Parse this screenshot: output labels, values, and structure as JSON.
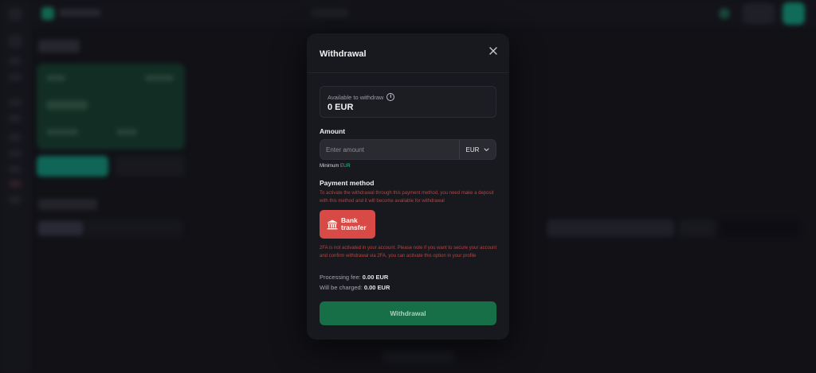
{
  "colors": {
    "accent_green": "#22c985",
    "submit_green": "#176f47",
    "bank_red": "#d84a45",
    "warning_red": "#b8443f",
    "modal_bg": "#18191e"
  },
  "modal": {
    "title": "Withdrawal",
    "close_icon": "close-icon",
    "balance": {
      "label": "Available to withdraw",
      "info_icon": "info-icon",
      "value": "0 EUR"
    },
    "amount": {
      "label": "Amount",
      "placeholder": "Enter amount",
      "value": "",
      "currency": "EUR",
      "minimum_label": "Minimum",
      "minimum_value": "EUR"
    },
    "payment_method": {
      "label": "Payment method",
      "notice": "To activate the withdrawal through this payment method, you need make a deposit with this method and it will become available for withdrawal",
      "methods": [
        {
          "label": "Bank transfer",
          "icon": "bank-icon",
          "selected": true
        }
      ]
    },
    "twofa_notice": "2FA is not activated in your account. Please note if you want to secure your account and confirm withdrawal via 2FA, you can activate this option in your profile",
    "fees": {
      "processing_label": "Processing fee:",
      "processing_value": "0.00 EUR",
      "charged_label": "Will be charged:",
      "charged_value": "0.00 EUR"
    },
    "submit_label": "Withdrawal"
  }
}
